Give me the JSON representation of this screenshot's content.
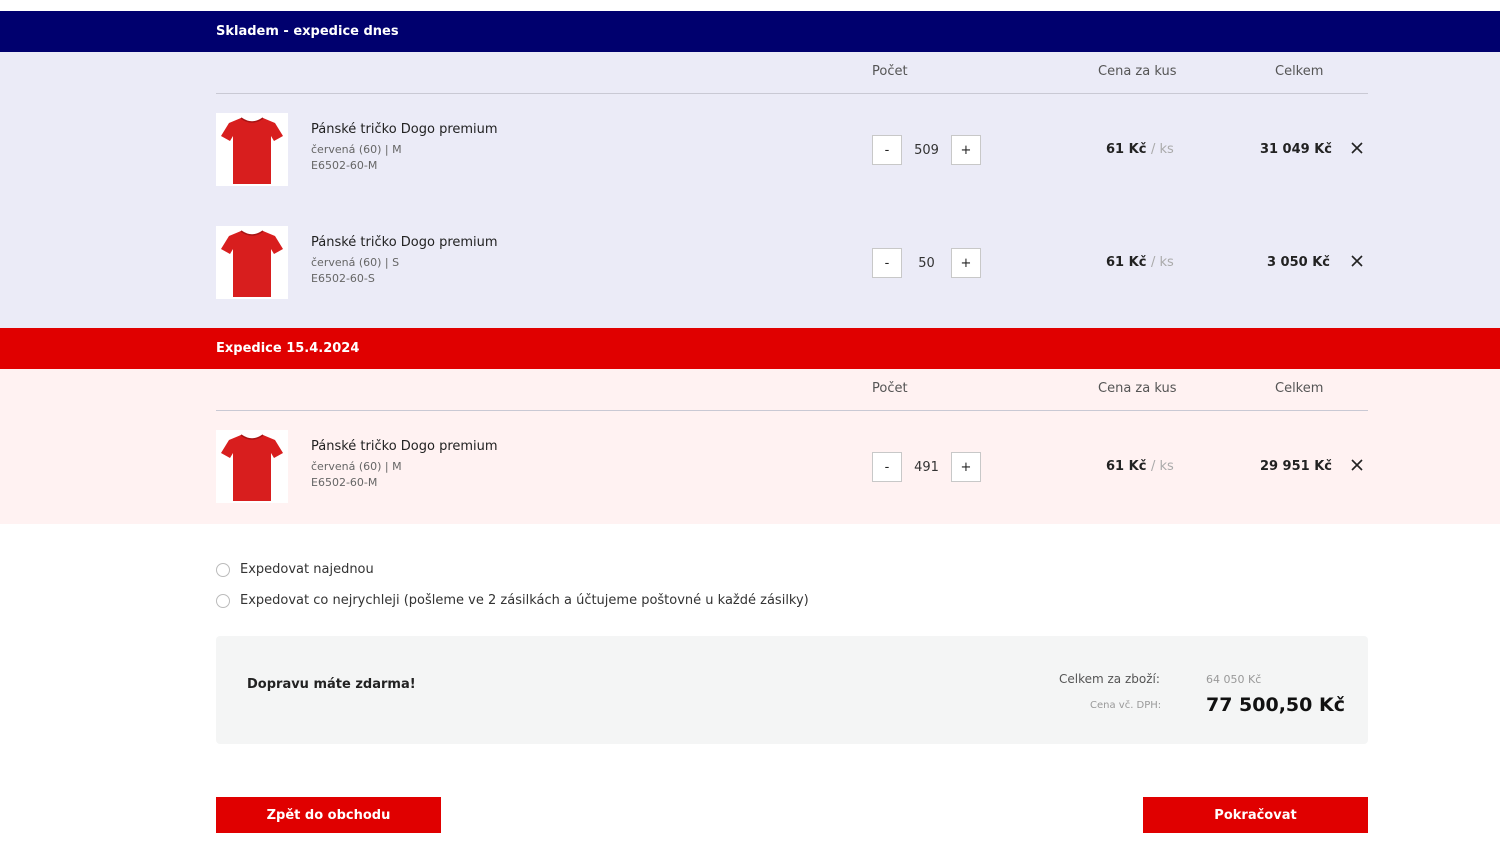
{
  "columns": {
    "qty": "Počet",
    "unit_price": "Cena za kus",
    "total": "Celkem"
  },
  "groups": [
    {
      "title": "Skladem - expedice dnes",
      "color": "#00006e",
      "bg": "#ebebf7",
      "items": [
        {
          "name": "Pánské tričko Dogo premium",
          "variant": "červená (60) | M",
          "code": "E6502-60-M",
          "qty": "509",
          "unit_price": "61 Kč",
          "unit": "/ ks",
          "total": "31 049 Kč",
          "minus": "-",
          "plus": "+"
        },
        {
          "name": "Pánské tričko Dogo premium",
          "variant": "červená (60) | S",
          "code": "E6502-60-S",
          "qty": "50",
          "unit_price": "61 Kč",
          "unit": "/ ks",
          "total": "3 050 Kč",
          "minus": "-",
          "plus": "+"
        }
      ]
    },
    {
      "title": "Expedice 15.4.2024",
      "color": "#e00000",
      "bg": "#fff2f2",
      "items": [
        {
          "name": "Pánské tričko Dogo premium",
          "variant": "červená (60) | M",
          "code": "E6502-60-M",
          "qty": "491",
          "unit_price": "61 Kč",
          "unit": "/ ks",
          "total": "29 951 Kč",
          "minus": "-",
          "plus": "+"
        }
      ]
    }
  ],
  "shipping_options": [
    {
      "label": "Expedovat najednou",
      "selected": false
    },
    {
      "label": "Expedovat co nejrychleji (pošleme ve 2 zásilkách a účtujeme poštovné u každé zásilky)",
      "selected": false
    }
  ],
  "summary": {
    "free_shipping": "Dopravu máte zdarma!",
    "goods_label": "Celkem za zboží:",
    "goods_value": "64 050 Kč",
    "vat_label": "Cena vč. DPH:",
    "vat_value": "77 500,50 Kč"
  },
  "buttons": {
    "back": "Zpět do obchodu",
    "continue": "Pokračovat"
  },
  "icons": {
    "product_image": "red-tshirt-icon",
    "remove": "close-icon"
  }
}
